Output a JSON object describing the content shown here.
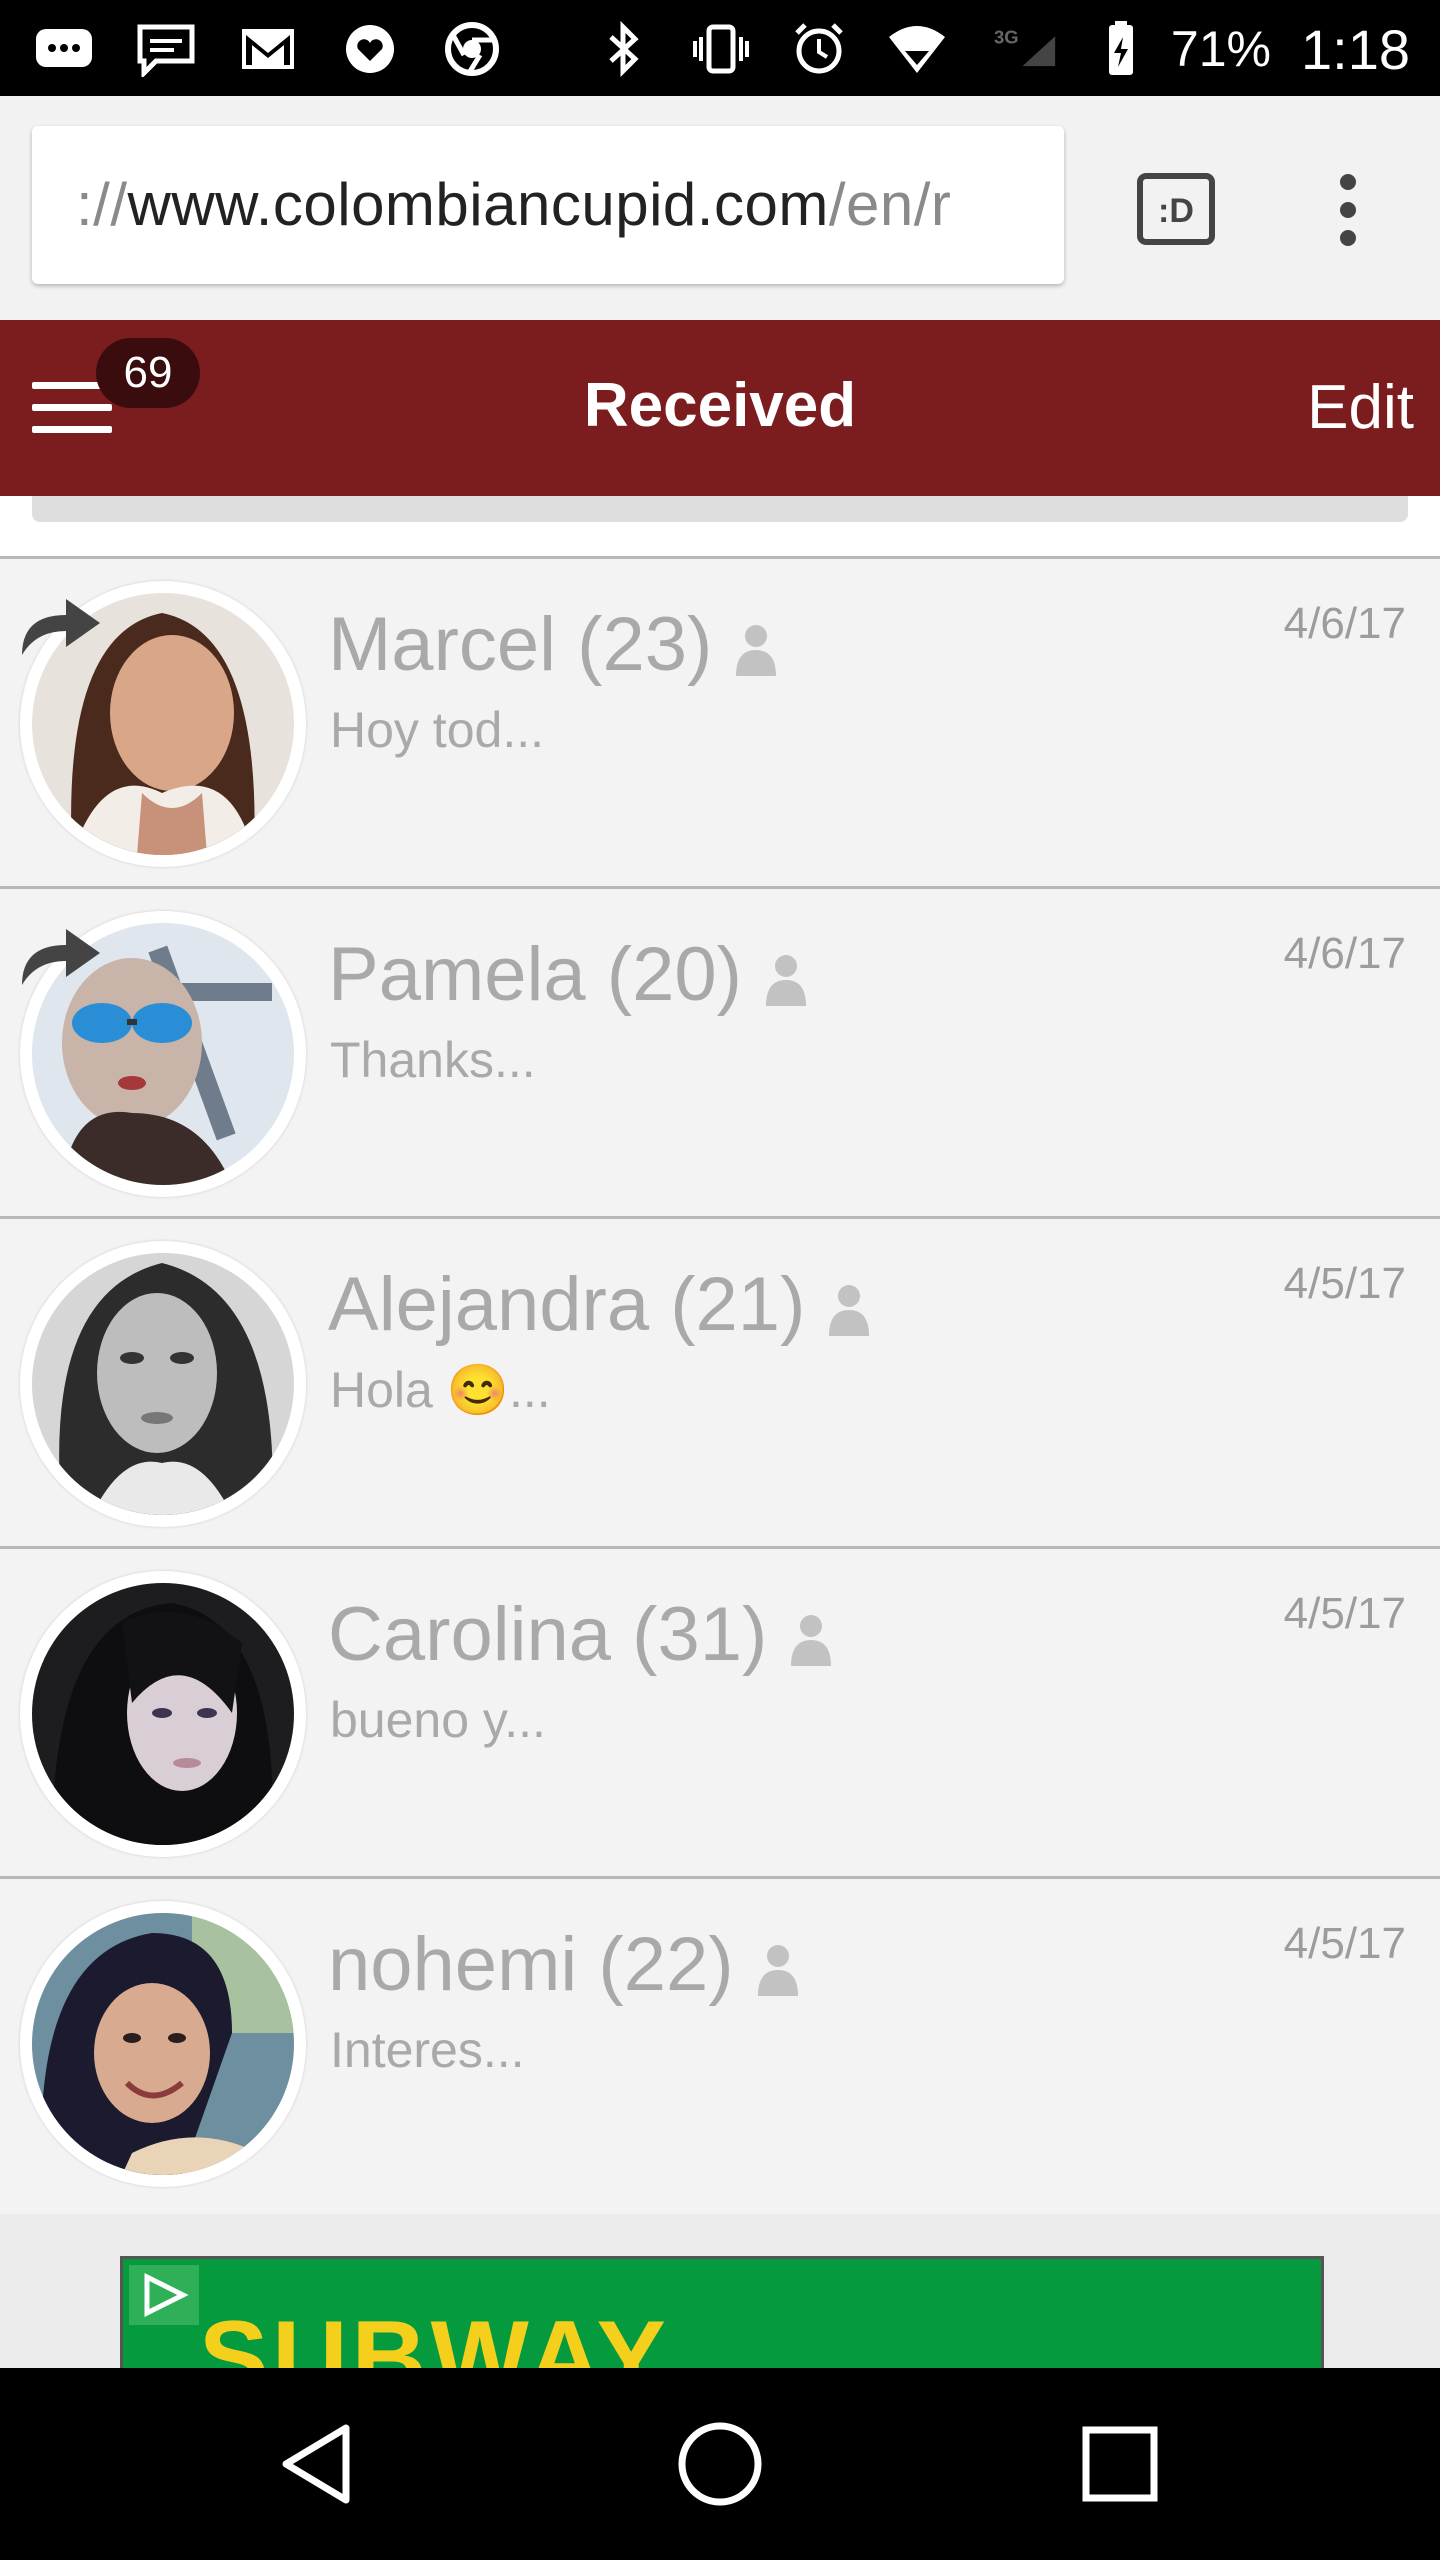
{
  "status_bar": {
    "battery": "71%",
    "time": "1:18",
    "network": "3G",
    "left_icons": [
      "chat-bubble-icon",
      "message-icon",
      "gmail-icon",
      "heart-icon",
      "chrome-icon"
    ],
    "right_icons": [
      "bluetooth-icon",
      "vibrate-icon",
      "alarm-icon",
      "wifi-icon",
      "signal-icon",
      "battery-icon"
    ]
  },
  "browser": {
    "url_prefix": "://",
    "url_domain": "www.colombiancupid.com",
    "url_suffix": "/en/r",
    "tab_button_label": ":D"
  },
  "header": {
    "title": "Received",
    "edit_label": "Edit",
    "badge_count": "69",
    "color": "#7b1d1f"
  },
  "messages": [
    {
      "name": "Marcel (23)",
      "preview": "Hoy tod...",
      "date": "4/6/17",
      "replied": true
    },
    {
      "name": "Pamela (20)",
      "preview": "Thanks...",
      "date": "4/6/17",
      "replied": true
    },
    {
      "name": "Alejandra (21)",
      "preview": "Hola 😊...",
      "date": "4/5/17",
      "replied": false
    },
    {
      "name": "Carolina (31)",
      "preview": "bueno y...",
      "date": "4/5/17",
      "replied": false
    },
    {
      "name": "nohemi (22)",
      "preview": "Interes...",
      "date": "4/5/17",
      "replied": false
    }
  ],
  "ad": {
    "text": "SUBWAY"
  },
  "nav": {
    "icons": [
      "back-icon",
      "home-icon",
      "recents-icon"
    ]
  }
}
